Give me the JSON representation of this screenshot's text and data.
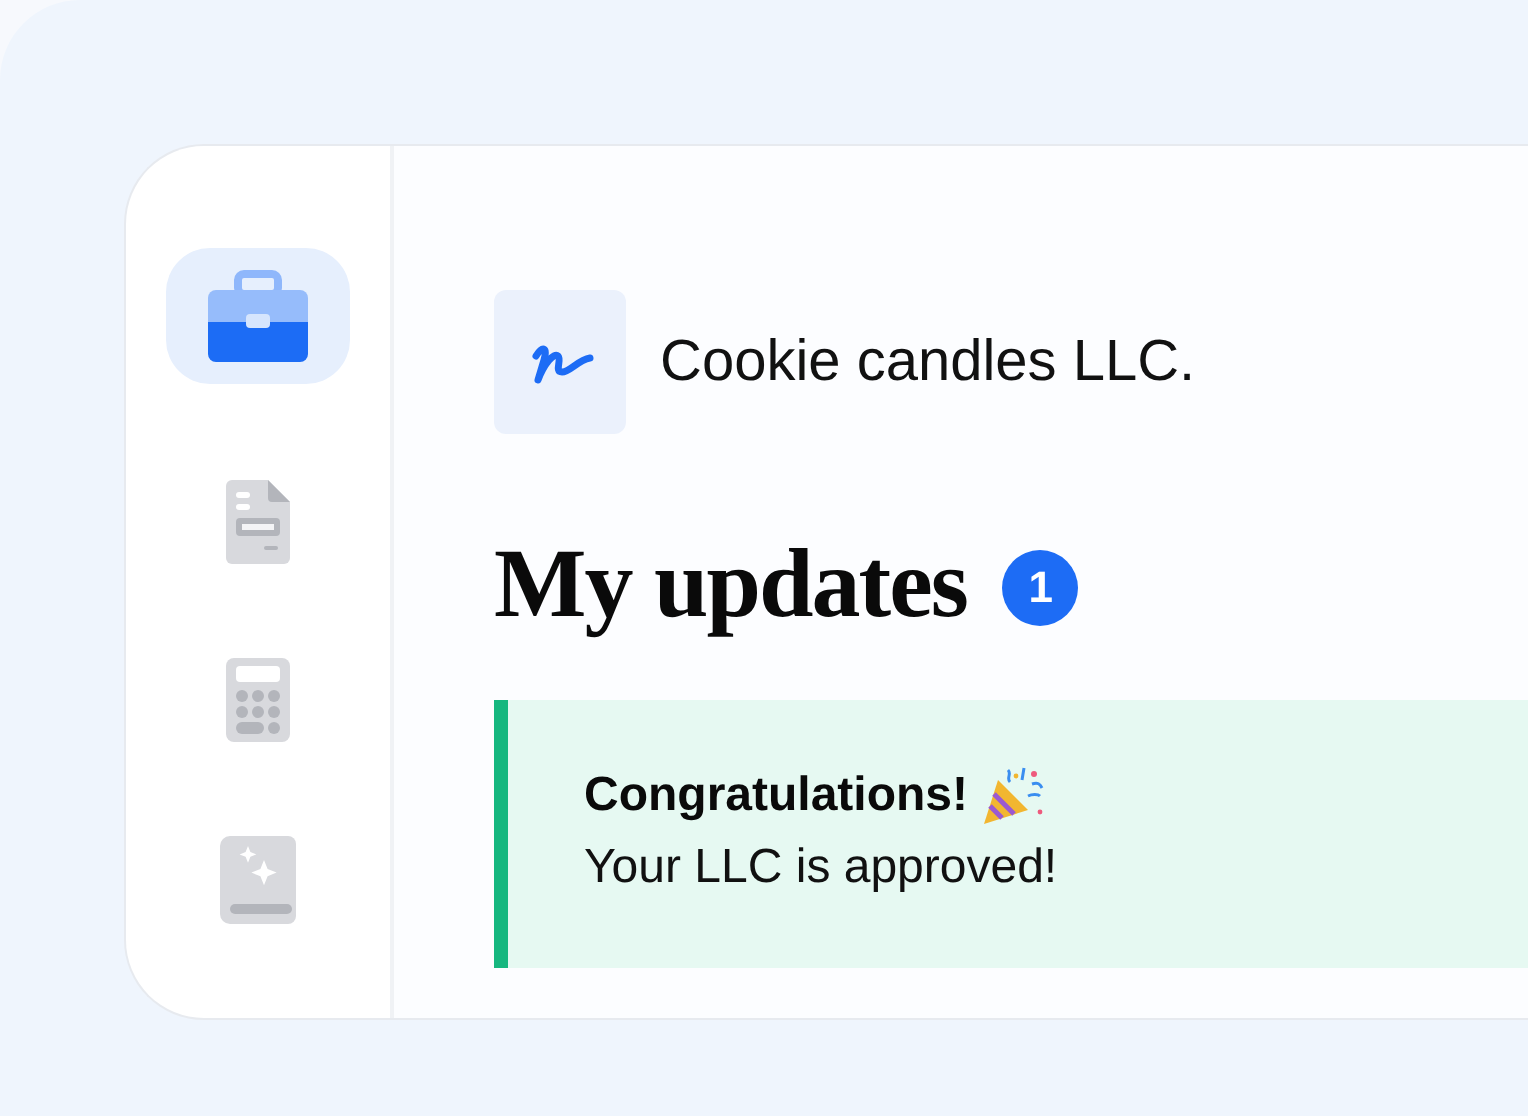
{
  "sidebar": {
    "items": [
      {
        "kind": "briefcase",
        "selected": true
      },
      {
        "kind": "document",
        "selected": false
      },
      {
        "kind": "calculator",
        "selected": false
      },
      {
        "kind": "book",
        "selected": false
      }
    ]
  },
  "company": {
    "name": "Cookie candles LLC."
  },
  "updates": {
    "title": "My updates",
    "count": "1"
  },
  "alert": {
    "title": "Congratulations!",
    "message": "Your LLC is approved!"
  }
}
